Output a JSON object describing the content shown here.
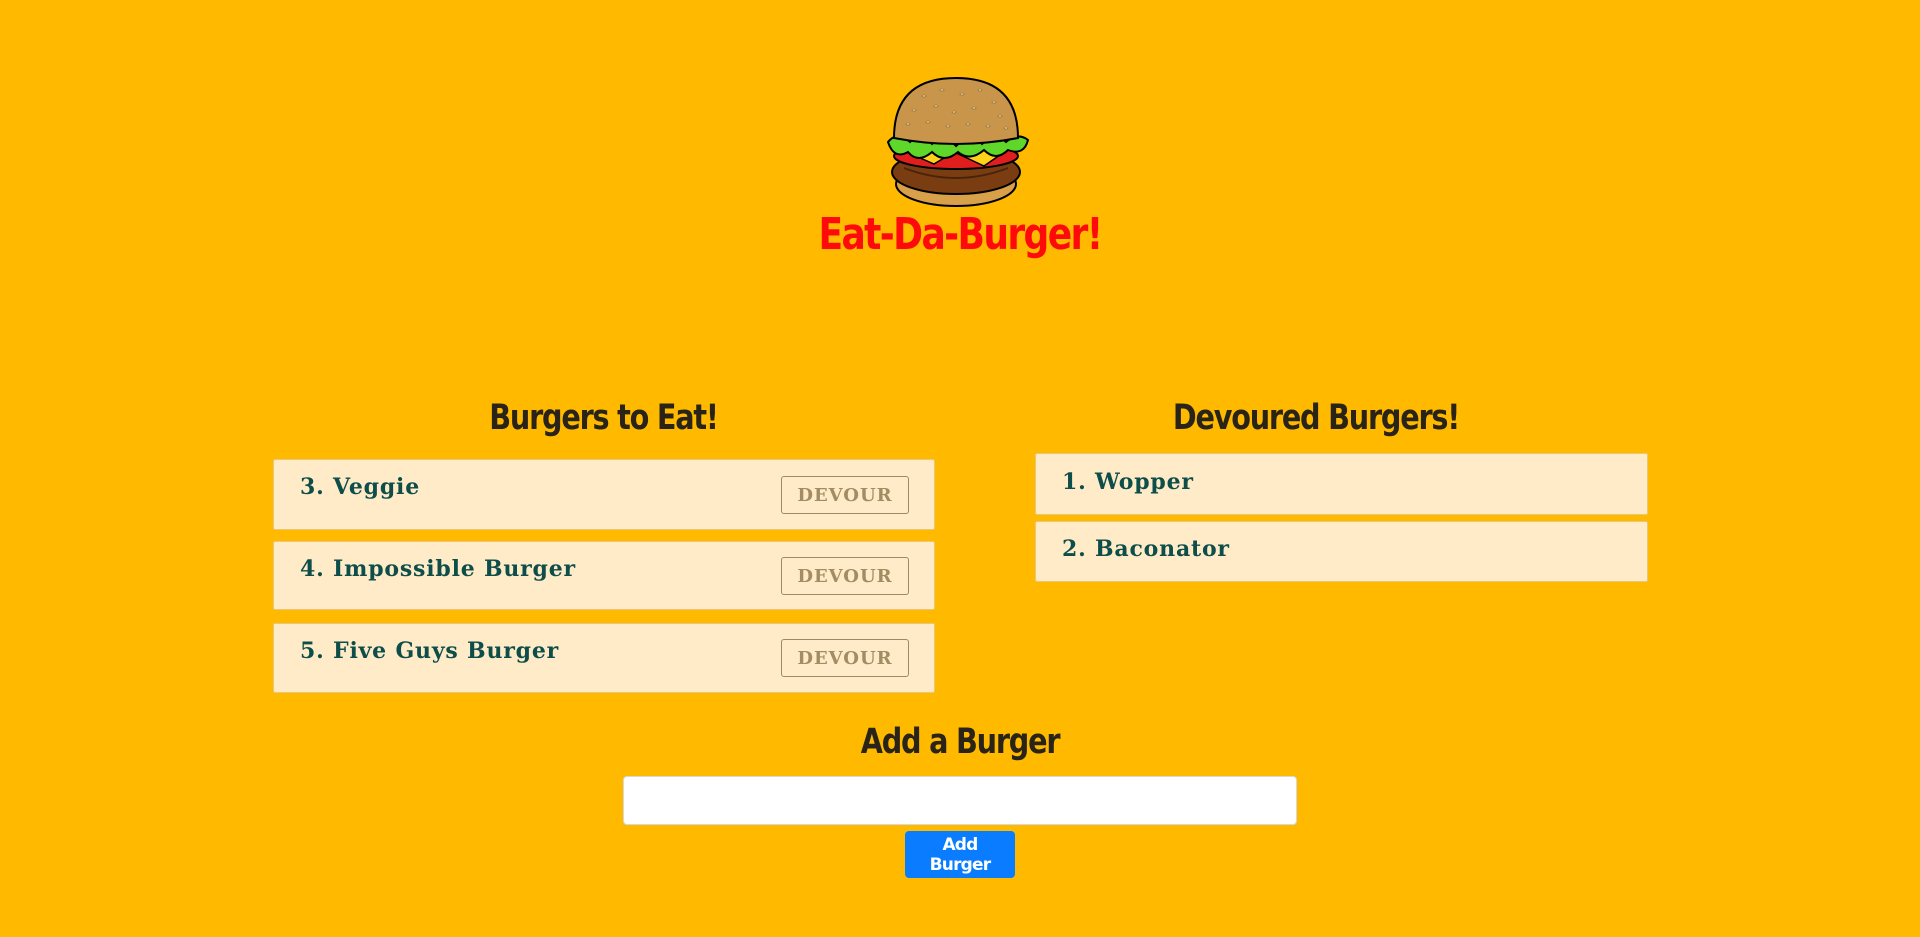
{
  "header": {
    "logo": "hamburger-icon",
    "title": "Eat-Da-Burger!"
  },
  "to_eat": {
    "title": "Burgers to Eat!",
    "items": [
      {
        "label": "3. Veggie",
        "button": "DEVOUR"
      },
      {
        "label": "4. Impossible Burger",
        "button": "DEVOUR"
      },
      {
        "label": "5. Five Guys Burger",
        "button": "DEVOUR"
      }
    ]
  },
  "devoured": {
    "title": "Devoured Burgers!",
    "items": [
      {
        "label": "1. Wopper"
      },
      {
        "label": "2. Baconator"
      }
    ]
  },
  "add_form": {
    "title": "Add a Burger",
    "input_value": "",
    "input_placeholder": "",
    "button": "Add Burger"
  },
  "colors": {
    "background": "#FFBA00",
    "title": "#FF0A0A",
    "item_bg": "#FFEBC8",
    "item_text": "#0d4d4a",
    "add_button": "#0A7CFF"
  }
}
